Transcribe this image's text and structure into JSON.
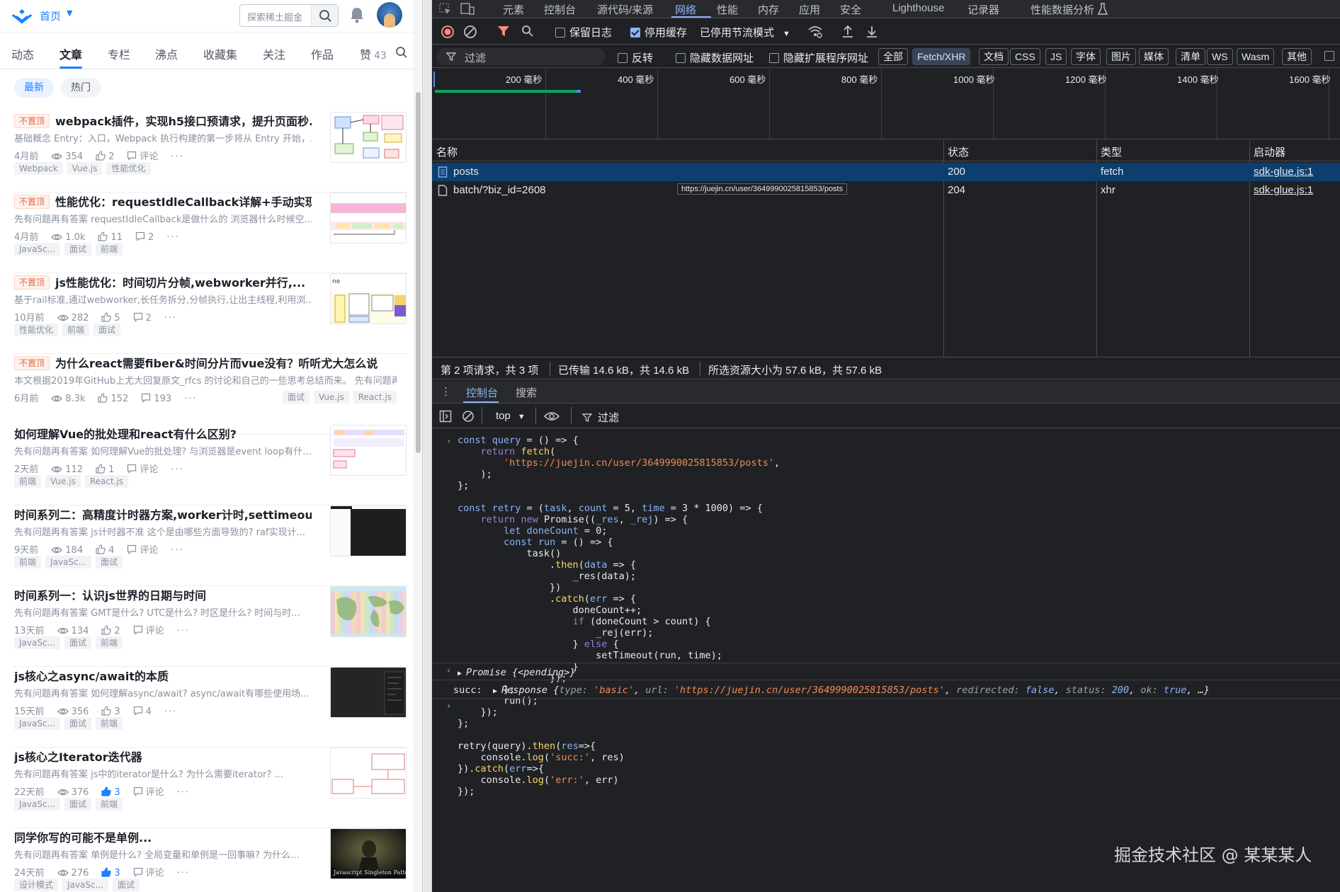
{
  "left": {
    "topbar": {
      "home_label": "首页",
      "search_placeholder": "探索稀土掘金"
    },
    "nav_tabs": [
      "动态",
      "文章",
      "专栏",
      "沸点",
      "收藏集",
      "关注",
      "作品"
    ],
    "likes": {
      "label": "赞",
      "count": "43"
    },
    "sub_tabs": {
      "active": "最新",
      "inactive": "热门"
    },
    "articles": [
      {
        "pinned": true,
        "pin_label": "不置顶",
        "title": "webpack插件，实现h5接口预请求，提升页面秒...",
        "desc": "基础概念 Entry：入口，Webpack 执行构建的第一步将从 Entry 开始，...",
        "time": "4月前",
        "views": "354",
        "likes": "2",
        "comments": "评论",
        "tags": [
          "Webpack",
          "Vue.js",
          "性能优化"
        ]
      },
      {
        "pinned": true,
        "pin_label": "不置顶",
        "title": "性能优化：requestIdleCallback详解+手动实现",
        "desc": "先有问题再有答案 requestIdleCallback是做什么的 浏览器什么时候空...",
        "time": "4月前",
        "views": "1.0k",
        "likes": "11",
        "comments": "2",
        "tags": [
          "JavaSc...",
          "面试",
          "前端"
        ]
      },
      {
        "pinned": true,
        "pin_label": "不置顶",
        "title": "js性能优化：时间切片分帧,webworker并行,...",
        "desc": "基于rail标准,通过webworker,长任务拆分,分帧执行,让出主线程,利用浏...",
        "time": "10月前",
        "views": "282",
        "likes": "5",
        "comments": "2",
        "tags": [
          "性能优化",
          "前端",
          "面试"
        ]
      },
      {
        "pinned": true,
        "pin_label": "不置顶",
        "title": "为什么react需要fiber&时间分片而vue没有？听听尤大怎么说",
        "desc": "本文根据2019年GitHub上尤大回复原文_rfcs 的讨论和自己的一些思考总结而来。 先有问题再...",
        "time": "6月前",
        "views": "8.3k",
        "likes": "152",
        "comments": "193",
        "tags": [
          "面试",
          "Vue.js",
          "React.js"
        ]
      },
      {
        "pinned": false,
        "title": "如何理解Vue的批处理和react有什么区别?",
        "desc": "先有问题再有答案 如何理解Vue的批处理? 与浏览器是event loop有什...",
        "time": "2天前",
        "views": "112",
        "likes": "1",
        "comments": "评论",
        "tags": [
          "前端",
          "Vue.js",
          "React.js"
        ]
      },
      {
        "pinned": false,
        "title": "时间系列二：高精度计时器方案,worker计时,settimeout...",
        "desc": "先有问题再有答案 js计时器不准 这个是由哪些方面导致的? raf实现计...",
        "time": "9天前",
        "views": "184",
        "likes": "4",
        "comments": "评论",
        "tags": [
          "前端",
          "JavaSc...",
          "面试"
        ]
      },
      {
        "pinned": false,
        "title": "时间系列一：认识js世界的日期与时间",
        "desc": "先有问题再有答案 GMT是什么? UTC是什么? 时区是什么? 时间与时...",
        "time": "13天前",
        "views": "134",
        "likes": "2",
        "comments": "评论",
        "tags": [
          "JavaSc...",
          "面试",
          "前端"
        ]
      },
      {
        "pinned": false,
        "title": "js核心之async/await的本质",
        "desc": "先有问题再有答案 如何理解async/await? async/await有哪些使用场...",
        "time": "15天前",
        "views": "356",
        "likes": "3",
        "comments": "4",
        "tags": [
          "JavaSc...",
          "面试",
          "前端"
        ]
      },
      {
        "pinned": false,
        "title": "js核心之Iterator迭代器",
        "desc": "先有问题再有答案 js中的iterator是什么? 为什么需要iterator? ...",
        "time": "22天前",
        "views": "376",
        "likes": "3",
        "liked": true,
        "comments": "评论",
        "tags": [
          "JavaSc...",
          "面试",
          "前端"
        ]
      },
      {
        "pinned": false,
        "title": "同学你写的可能不是单例...",
        "desc": "先有问题再有答案 单例是什么? 全局变量和单例是一回事嘛? 为什么...",
        "time": "24天前",
        "views": "276",
        "likes": "3",
        "liked": true,
        "comments": "评论",
        "tags": [
          "设计模式",
          "JavaSc...",
          "面试"
        ],
        "thumb_text": "Javascript Singleton Pattern"
      }
    ],
    "thumb_misc": {
      "t3": "ne"
    }
  },
  "devtools": {
    "tabs": [
      "元素",
      "控制台",
      "源代码/来源",
      "网络",
      "性能",
      "内存",
      "应用",
      "安全",
      "Lighthouse",
      "记录器",
      "性能数据分析"
    ],
    "toolbar": {
      "preserve_log": "保留日志",
      "disable_cache": "停用缓存",
      "throttle": "已停用节流模式"
    },
    "filter": {
      "placeholder": "过滤",
      "invert": "反转",
      "hide_data_urls": "隐藏数据网址",
      "hide_ext_urls": "隐藏扩展程序网址"
    },
    "type_chips": [
      "全部",
      "Fetch/XHR",
      "文档",
      "CSS",
      "JS",
      "字体",
      "图片",
      "媒体",
      "清单",
      "WS",
      "Wasm",
      "其他"
    ],
    "timeline_labels": [
      "200 毫秒",
      "400 毫秒",
      "600 毫秒",
      "800 毫秒",
      "1000 毫秒",
      "1200 毫秒",
      "1400 毫秒",
      "1600 毫秒"
    ],
    "table": {
      "headers": [
        "名称",
        "状态",
        "类型",
        "启动器"
      ],
      "rows": [
        {
          "name": "posts",
          "status": "200",
          "type": "fetch",
          "initiator": "sdk-glue.js:1"
        },
        {
          "name": "batch/?biz_id=2608",
          "status": "204",
          "type": "xhr",
          "initiator": "sdk-glue.js:1"
        }
      ],
      "tooltip": "https://juejin.cn/user/3649990025815853/posts"
    },
    "status": [
      "第 2 项请求，共 3 项",
      "已传输 14.6 kB，共 14.6 kB",
      "所选资源大小为 57.6 kB，共 57.6 kB"
    ],
    "drawer_tabs": [
      "控制台",
      "搜索"
    ],
    "console_toolbar": {
      "context": "top",
      "filter": "过滤"
    },
    "code_url": "'https://juejin.cn/user/3649990025815853/posts'",
    "promise_line": "Promise {<pending>}",
    "succ_label": "succ:",
    "response": {
      "prefix": "Response {",
      "type_key": "type:",
      "type_val": "'basic'",
      "url_key": "url:",
      "url_val": "'https://juejin.cn/user/3649990025815853/posts'",
      "redirected_key": "redirected:",
      "redirected_val": "false",
      "status_key": "status:",
      "status_val": "200",
      "ok_key": "ok:",
      "ok_val": "true",
      "suffix": "…}"
    },
    "watermark": "掘金技术社区 @ 某某某人"
  }
}
